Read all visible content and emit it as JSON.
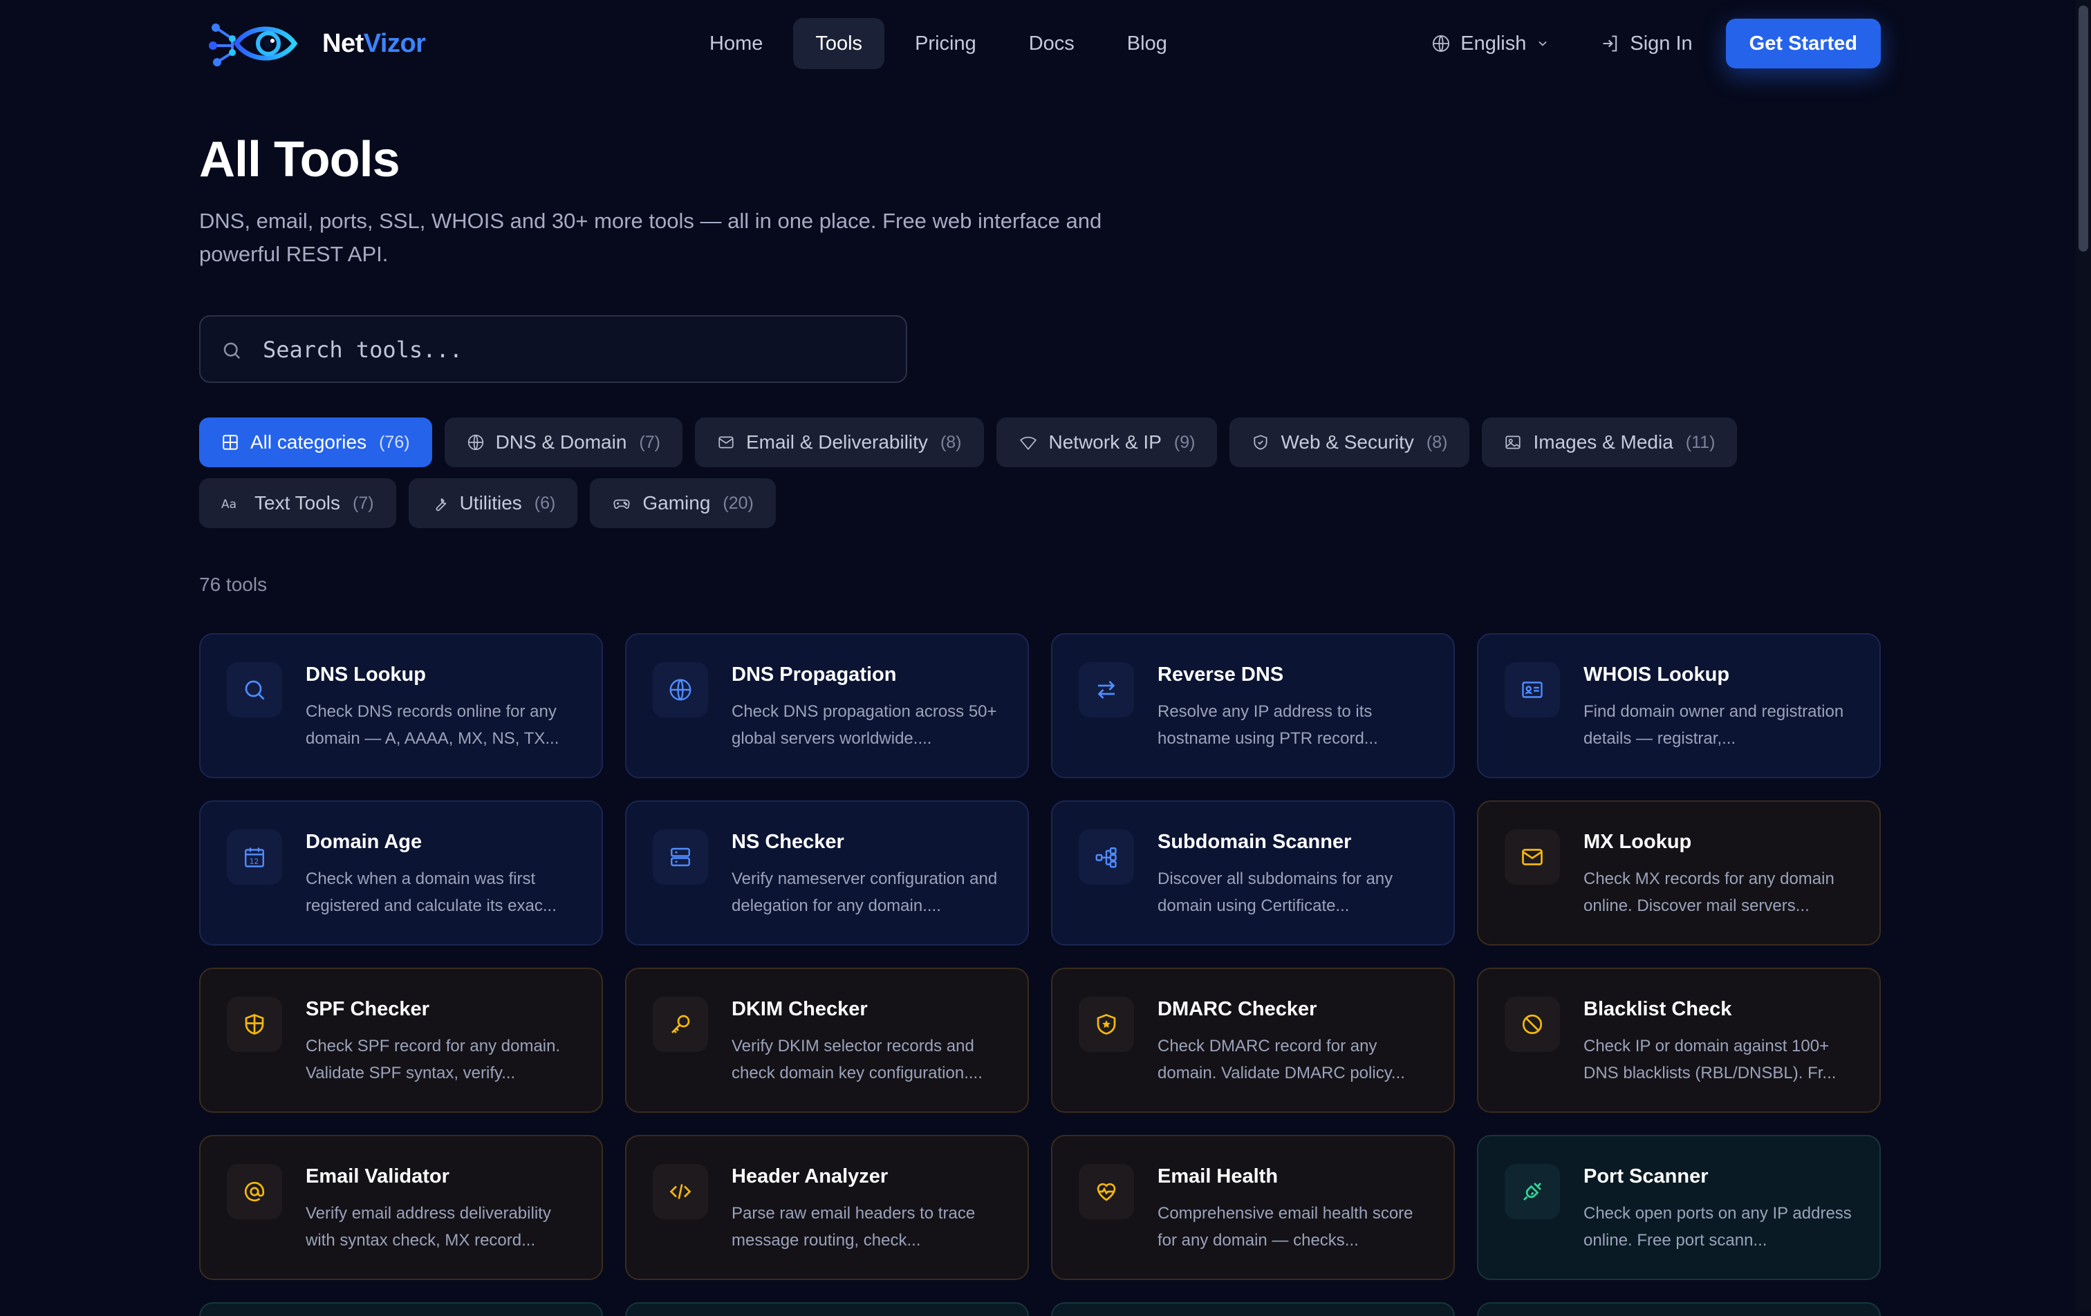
{
  "brand": {
    "name_a": "Net",
    "name_b": "Vizor"
  },
  "nav": [
    {
      "label": "Home",
      "active": false
    },
    {
      "label": "Tools",
      "active": true
    },
    {
      "label": "Pricing",
      "active": false
    },
    {
      "label": "Docs",
      "active": false
    },
    {
      "label": "Blog",
      "active": false
    }
  ],
  "header": {
    "language": "English",
    "sign_in": "Sign In",
    "cta": "Get Started"
  },
  "hero": {
    "title": "All Tools",
    "subtitle": "DNS, email, ports, SSL, WHOIS and 30+ more tools — all in one place. Free web interface and powerful REST API."
  },
  "search": {
    "placeholder": "Search tools...",
    "value": ""
  },
  "categories": [
    {
      "label": "All categories",
      "count": "(76)",
      "icon": "grid-icon",
      "active": true
    },
    {
      "label": "DNS & Domain",
      "count": "(7)",
      "icon": "globe-icon",
      "active": false
    },
    {
      "label": "Email & Deliverability",
      "count": "(8)",
      "icon": "mail-icon",
      "active": false
    },
    {
      "label": "Network & IP",
      "count": "(9)",
      "icon": "wifi-icon",
      "active": false
    },
    {
      "label": "Web & Security",
      "count": "(8)",
      "icon": "shield-icon",
      "active": false
    },
    {
      "label": "Images & Media",
      "count": "(11)",
      "icon": "image-icon",
      "active": false
    },
    {
      "label": "Text Tools",
      "count": "(7)",
      "icon": "text-icon",
      "active": false
    },
    {
      "label": "Utilities",
      "count": "(6)",
      "icon": "wrench-icon",
      "active": false
    },
    {
      "label": "Gaming",
      "count": "(20)",
      "icon": "gamepad-icon",
      "active": false
    }
  ],
  "tools_count": "76 tools",
  "colors": {
    "accent": "#2563eb",
    "blue_icon": "#4f8dff",
    "amber_icon": "#f5b90b",
    "teal_icon": "#34d399"
  },
  "tools": [
    {
      "title": "DNS Lookup",
      "desc": "Check DNS records online for any domain — A, AAAA, MX, NS, TX...",
      "icon": "search-icon",
      "theme": "blue"
    },
    {
      "title": "DNS Propagation",
      "desc": "Check DNS propagation across 50+ global servers worldwide....",
      "icon": "globe-icon",
      "theme": "blue"
    },
    {
      "title": "Reverse DNS",
      "desc": "Resolve any IP address to its hostname using PTR record...",
      "icon": "swap-icon",
      "theme": "blue"
    },
    {
      "title": "WHOIS Lookup",
      "desc": "Find domain owner and registration details — registrar,...",
      "icon": "id-card-icon",
      "theme": "blue"
    },
    {
      "title": "Domain Age",
      "desc": "Check when a domain was first registered and calculate its exac...",
      "icon": "calendar-icon",
      "theme": "blue"
    },
    {
      "title": "NS Checker",
      "desc": "Verify nameserver configuration and delegation for any domain....",
      "icon": "server-icon",
      "theme": "blue"
    },
    {
      "title": "Subdomain Scanner",
      "desc": "Discover all subdomains for any domain using Certificate...",
      "icon": "network-icon",
      "theme": "blue"
    },
    {
      "title": "MX Lookup",
      "desc": "Check MX records for any domain online. Discover mail servers...",
      "icon": "mail-icon",
      "theme": "amber"
    },
    {
      "title": "SPF Checker",
      "desc": "Check SPF record for any domain. Validate SPF syntax, verify...",
      "icon": "shield-half-icon",
      "theme": "amber"
    },
    {
      "title": "DKIM Checker",
      "desc": "Verify DKIM selector records and check domain key configuration....",
      "icon": "key-icon",
      "theme": "amber"
    },
    {
      "title": "DMARC Checker",
      "desc": "Check DMARC record for any domain. Validate DMARC policy...",
      "icon": "shield-star-icon",
      "theme": "amber"
    },
    {
      "title": "Blacklist Check",
      "desc": "Check IP or domain against 100+ DNS blacklists (RBL/DNSBL). Fr...",
      "icon": "ban-icon",
      "theme": "amber"
    },
    {
      "title": "Email Validator",
      "desc": "Verify email address deliverability with syntax check, MX record...",
      "icon": "at-icon",
      "theme": "amber"
    },
    {
      "title": "Header Analyzer",
      "desc": "Parse raw email headers to trace message routing, check...",
      "icon": "code-icon",
      "theme": "amber"
    },
    {
      "title": "Email Health",
      "desc": "Comprehensive email health score for any domain — checks...",
      "icon": "heart-pulse-icon",
      "theme": "amber"
    },
    {
      "title": "Port Scanner",
      "desc": "Check open ports on any IP address online. Free port scann...",
      "icon": "plug-icon",
      "theme": "teal"
    }
  ]
}
